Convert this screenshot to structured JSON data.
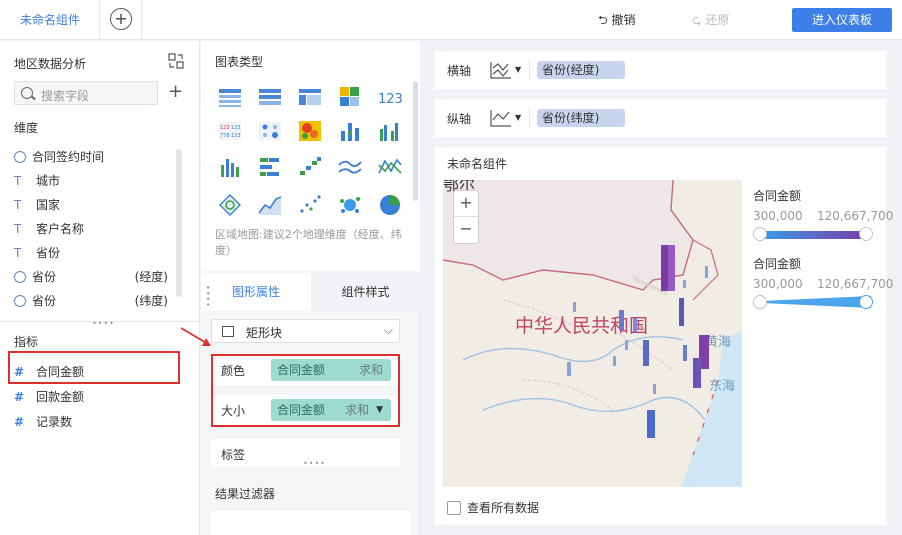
{
  "topbar": {
    "tab_label": "未命名组件",
    "undo_label": "撤销",
    "redo_label": "还原",
    "enter_dashboard": "进入仪表板"
  },
  "left": {
    "dataset_title": "地区数据分析",
    "search_placeholder": "搜索字段",
    "dimension_label": "维度",
    "dimensions": [
      {
        "name": "合同签约时间",
        "type": "time",
        "sub": ""
      },
      {
        "name": "城市",
        "type": "text",
        "sub": ""
      },
      {
        "name": "国家",
        "type": "text",
        "sub": ""
      },
      {
        "name": "客户名称",
        "type": "text",
        "sub": ""
      },
      {
        "name": "省份",
        "type": "text",
        "sub": ""
      },
      {
        "name": "省份",
        "type": "geo",
        "sub": "(经度)"
      },
      {
        "name": "省份",
        "type": "geo",
        "sub": "(纬度)"
      }
    ],
    "measure_label": "指标",
    "measures": [
      {
        "name": "合同金额",
        "icon": "#"
      },
      {
        "name": "回款金额",
        "icon": "#"
      },
      {
        "name": "记录数",
        "icon": "#"
      }
    ]
  },
  "middle": {
    "chart_type_title": "图表类型",
    "chart_tip": "区域地图:建议2个地理维度（经度、纬度）",
    "tab_graph": "图形属性",
    "tab_style": "组件样式",
    "shape_value": "矩形块",
    "color_label": "颜色",
    "color_field": "合同金额",
    "color_agg": "求和",
    "size_label": "大小",
    "size_field": "合同金额",
    "size_agg": "求和",
    "label_label": "标签",
    "result_filter": "结果过滤器"
  },
  "right": {
    "x_axis_label": "横轴",
    "x_axis_field": "省份(经度)",
    "y_axis_label": "纵轴",
    "y_axis_field": "省份(纬度)",
    "component_title": "未命名组件",
    "map_labels": {
      "country": "中华人民共和国",
      "sea1": "黄海",
      "sea2": "东海",
      "corner": "鄂尔"
    },
    "legend_color": {
      "title": "合同金额",
      "min": "300,000",
      "max": "120,667,700",
      "from": "#3a9be8",
      "to": "#7a3aa8"
    },
    "legend_size": {
      "title": "合同金额",
      "min": "300,000",
      "max": "120,667,700",
      "color": "#4aa5ea"
    },
    "show_all": "查看所有数据"
  }
}
